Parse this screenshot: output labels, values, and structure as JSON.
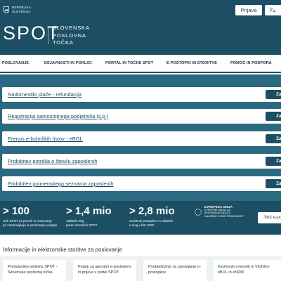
{
  "header": {
    "gov_line1": "REPUBLIKA",
    "gov_line2": "SLOVENIJA",
    "logo": "SPOT",
    "logo_line1": "SLOVENSKA",
    "logo_line2": "POSLOVNA",
    "logo_line3": "TOČKA",
    "login_label": "Prijava",
    "lang_label": "A",
    "icons": {
      "crest": "slovenia-crest-icon",
      "translate": "translate-icon"
    }
  },
  "nav": {
    "items": [
      {
        "label": "POSLOVANJE"
      },
      {
        "label": "DEJAVNOSTI IN POKLICI"
      },
      {
        "label": "PORTAL IN TOČKE SPOT"
      },
      {
        "label": "E-POSTOPKI IN STORITVE"
      },
      {
        "label": "POMOČ IN PODPORA"
      }
    ]
  },
  "services": [
    {
      "title": "Nadomestilo plače - refundacija",
      "button": "Začni"
    },
    {
      "title": "Registracija samostojnega podjetnika (s.p.)",
      "button": "Začni"
    },
    {
      "title": "Prenos e-bolniških listov - eBOL",
      "button": "Začni"
    },
    {
      "title": "Pridobitev potrdila o številu zaposlenih",
      "button": "Začni"
    },
    {
      "title": "Pridobitev poimenskega seznama zaposlenih",
      "button": "Začni"
    }
  ],
  "stats": [
    {
      "number": "> 100",
      "line1": "točk SPOT za pomoč in svetovanje",
      "line2": "pri ustanavljanju in poslovanju podjetja"
    },
    {
      "number": "> 1,4 mio",
      "line1": "oddanih vlog",
      "line2": "preko omrežnih SPOT"
    },
    {
      "number": "> 2,8 mio",
      "line1": "uvedenih postopkov in oddanih",
      "line2": "e-vlog v letu 2022"
    }
  ],
  "eu": {
    "line1": "EVROPSKA UNIJA",
    "line2": "EVROPSKI SKLAD ZA",
    "line3": "REGIONALNI RAZVOJ",
    "line4": "NALOŽBA V VAŠO PRIHODNOST"
  },
  "more_button": "Več e-postopkov",
  "info": {
    "title": "Informacije in elektronske storitve za poslovanje",
    "cards": [
      {
        "line1": "Predstavitev sistema SPOT -",
        "line2": "Slovenska poslovna točka"
      },
      {
        "line1": "Pogoji za uporabo e-postopkov",
        "line2": "in prijava v portal SPOT"
      },
      {
        "line1": "Pooblaščanje za opravljanje e-",
        "line2": "postopkov"
      },
      {
        "line1": "Kadrovski vmesnik in Vložišče",
        "line2": "eBOL in eNDM"
      }
    ]
  },
  "colors": {
    "primary": "#1c4f63",
    "band": "#2b6a80",
    "card_bg": "#edf1f3"
  }
}
